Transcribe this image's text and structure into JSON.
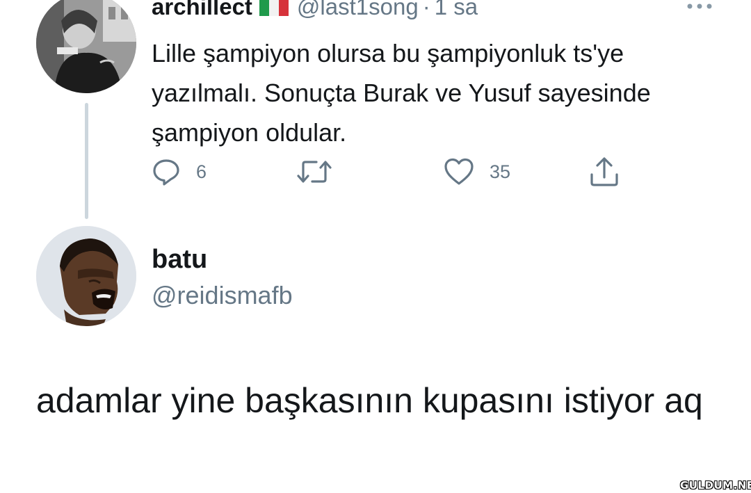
{
  "parent_tweet": {
    "display_name": "archillect",
    "flag_icon": "italy-flag-icon",
    "handle": "@last1song",
    "separator": "·",
    "time": "1 sa",
    "text": "Lille şampiyon olursa bu şampiyonluk ts'ye yazılmalı. Sonuçta Burak ve Yusuf sayesinde şampiyon oldular.",
    "actions": {
      "reply_count": "6",
      "retweet_count": "",
      "like_count": "35"
    }
  },
  "reply": {
    "display_name": "batu",
    "handle": "@reidismafb",
    "text": "adamlar yine başkasının kupasını istiyor aq"
  },
  "watermark": "GULDUM.NET",
  "colors": {
    "text_primary": "#14171a",
    "text_secondary": "#657786",
    "thread_line": "#ccd6dd"
  }
}
